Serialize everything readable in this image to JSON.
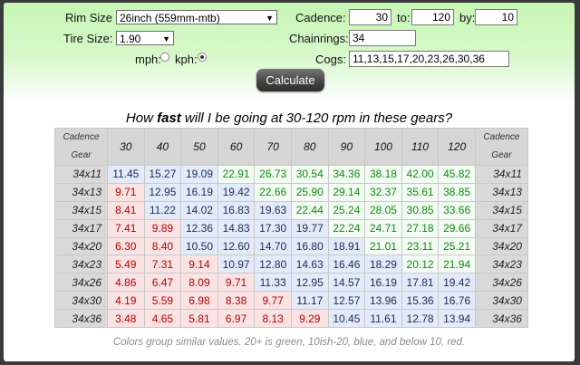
{
  "form": {
    "rim_size_label": "Rim Size",
    "rim_size_value": "26inch (559mm-mtb)",
    "tire_size_label": "Tire Size:",
    "tire_size_value": "1.90",
    "mph_label": "mph:",
    "kph_label": "kph:",
    "speed_unit_selected": "kph",
    "cadence_label": "Cadence:",
    "cadence_from": "30",
    "to_label": "to:",
    "cadence_to": "120",
    "by_label": "by:",
    "cadence_by": "10",
    "chainrings_label": "Chainrings:",
    "chainrings_value": "34",
    "cogs_label": "Cogs:",
    "cogs_value": "11,13,15,17,20,23,26,30,36",
    "calculate_label": "Calculate"
  },
  "heading": {
    "prefix": "How ",
    "bold": "fast",
    "suffix": " will I be going at 30-120 rpm in these gears?"
  },
  "table": {
    "corner_top": "Cadence",
    "corner_bottom": "Gear",
    "cadences": [
      "30",
      "40",
      "50",
      "60",
      "70",
      "80",
      "90",
      "100",
      "110",
      "120"
    ],
    "rows": [
      {
        "gear": "34x11",
        "values": [
          "11.45",
          "15.27",
          "19.09",
          "22.91",
          "26.73",
          "30.54",
          "34.36",
          "38.18",
          "42.00",
          "45.82"
        ]
      },
      {
        "gear": "34x13",
        "values": [
          "9.71",
          "12.95",
          "16.19",
          "19.42",
          "22.66",
          "25.90",
          "29.14",
          "32.37",
          "35.61",
          "38.85"
        ]
      },
      {
        "gear": "34x15",
        "values": [
          "8.41",
          "11.22",
          "14.02",
          "16.83",
          "19.63",
          "22.44",
          "25.24",
          "28.05",
          "30.85",
          "33.66"
        ]
      },
      {
        "gear": "34x17",
        "values": [
          "7.41",
          "9.89",
          "12.36",
          "14.83",
          "17.30",
          "19.77",
          "22.24",
          "24.71",
          "27.18",
          "29.66"
        ]
      },
      {
        "gear": "34x20",
        "values": [
          "6.30",
          "8.40",
          "10.50",
          "12.60",
          "14.70",
          "16.80",
          "18.91",
          "21.01",
          "23.11",
          "25.21"
        ]
      },
      {
        "gear": "34x23",
        "values": [
          "5.49",
          "7.31",
          "9.14",
          "10.97",
          "12.80",
          "14.63",
          "16.46",
          "18.29",
          "20.12",
          "21.94"
        ]
      },
      {
        "gear": "34x26",
        "values": [
          "4.86",
          "6.47",
          "8.09",
          "9.71",
          "11.33",
          "12.95",
          "14.57",
          "16.19",
          "17.81",
          "19.42"
        ]
      },
      {
        "gear": "34x30",
        "values": [
          "4.19",
          "5.59",
          "6.98",
          "8.38",
          "9.77",
          "11.17",
          "12.57",
          "13.96",
          "15.36",
          "16.76"
        ]
      },
      {
        "gear": "34x36",
        "values": [
          "3.48",
          "4.65",
          "5.81",
          "6.97",
          "8.13",
          "9.29",
          "10.45",
          "11.61",
          "12.78",
          "13.94"
        ]
      }
    ],
    "colors": {
      "green": "#0f8a12",
      "blue": "#1a2a55",
      "red": "#b80000"
    }
  },
  "footnote": "Colors group similar values. 20+ is green, 10ish-20, blue, and below 10, red."
}
